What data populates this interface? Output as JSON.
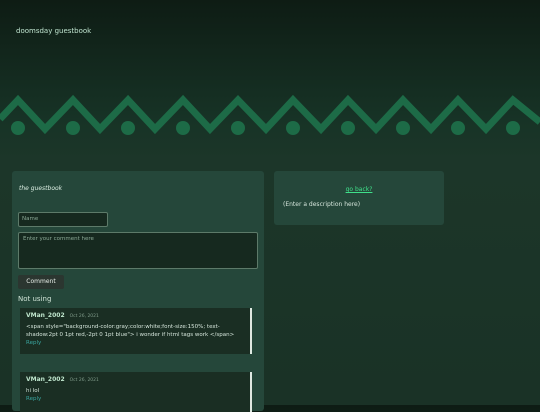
{
  "site": {
    "title": "doomsday guestbook"
  },
  "guestbook": {
    "heading": "the guestbook",
    "name_placeholder": "Name",
    "comment_placeholder": "Enter your comment here",
    "submit_label": "Comment",
    "section_label": "Not using"
  },
  "comments": [
    {
      "author": "VMan_2002",
      "date": "Oct 26, 2021",
      "body": "<span style=\"background-color:gray;color:white;font-size:150%; text-shadow:2pt 0 1pt red,-2pt 0 1pt blue\"> i wonder if html tags work </span>",
      "reply_label": "Reply"
    },
    {
      "author": "VMan_2002",
      "date": "Oct 26, 2021",
      "body": "hi lol",
      "reply_label": "Reply"
    }
  ],
  "sidebar": {
    "go_back_label": "go back?",
    "description": "(Enter a description here)"
  },
  "colors": {
    "banner": "#1d6b47",
    "panel": "#25473a",
    "link": "#3fe08a"
  }
}
